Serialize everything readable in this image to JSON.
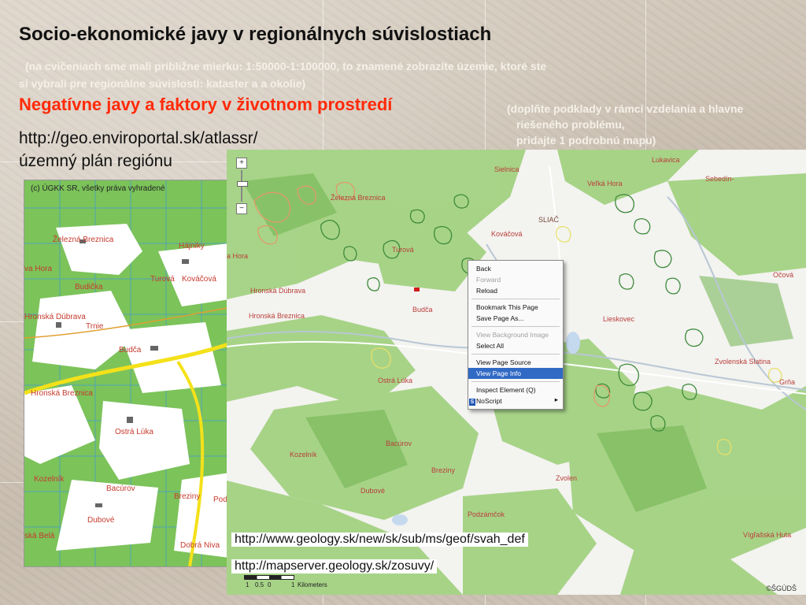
{
  "title": "Socio-ekonomické javy v regionálnych súvislostiach",
  "subnote_line1": "(na cvičeniach sme mali približne mierku: 1:50000-1:100000, to znamené zobrazíte územie, ktoré ste",
  "subnote_line2": "si vybrali pre regionálne súvislosti: kataster a a okolie)",
  "heading_red": "Negatívne javy a faktory v životnom prostredí",
  "heading_note_line1": "(doplňte podklady v rámci vzdelania a hlavne",
  "heading_note_line2": "riešeného problému,",
  "heading_note_line3": "pridajte 1 podrobnú mapu)",
  "url_atlas": "http://geo.enviroportal.sk/atlassr/",
  "url_atlas_caption": "územný plán regiónu",
  "left_map": {
    "copyright": "(c) ÚGKK SR, všetky práva vyhradené",
    "places": [
      "Železná Breznica",
      "Hájniky",
      "Turová",
      "Kováčová",
      "Budička",
      "Hronská Dúbrava",
      "Trnie",
      "Budča",
      "Hronská Breznica",
      "Ostrá Lúka",
      "Kozelník",
      "Bacúrov",
      "Breziny",
      "Dubové",
      "ská Belá",
      "Dobrá Niva",
      "va Hora",
      "Pod"
    ]
  },
  "main_map": {
    "places": [
      "Sielnica",
      "Lukavica",
      "Sebedín-",
      "Železná Breznica",
      "Veľká Hora",
      "Turová",
      "SLIAČ",
      "Kováčová",
      "Hronská Dúbrava",
      "Hronská Breznica",
      "Budča",
      "Lieskovec",
      "Zvolenská Slatina",
      "Ostrá Lúka",
      "Bacúrov",
      "Breziny",
      "Kozelník",
      "Dubové",
      "Podzámčok",
      "Zvolen",
      "Očová",
      "Vígľašská Huta",
      "Grňa",
      "a Hora"
    ],
    "scale_ticks": [
      "1",
      "0.5",
      "0",
      "1"
    ],
    "scale_unit": "Kilometers",
    "copyright": "©ŠGÚDŠ"
  },
  "context_menu": {
    "items": [
      {
        "label": "Back",
        "disabled": false
      },
      {
        "label": "Forward",
        "disabled": true
      },
      {
        "label": "Reload",
        "disabled": false
      },
      {
        "sep": true
      },
      {
        "label": "Bookmark This Page",
        "disabled": false
      },
      {
        "label": "Save Page As...",
        "disabled": false
      },
      {
        "sep": true
      },
      {
        "label": "View Background Image",
        "disabled": true
      },
      {
        "label": "Select All",
        "disabled": false
      },
      {
        "sep": true
      },
      {
        "label": "View Page Source",
        "disabled": false
      },
      {
        "label": "View Page Info",
        "disabled": false,
        "highlighted": true
      },
      {
        "sep": true
      },
      {
        "label": "Inspect Element (Q)",
        "disabled": false
      },
      {
        "label": "NoScript",
        "disabled": false,
        "submenu": true,
        "icon": "S"
      }
    ]
  },
  "links": {
    "svah": "http://www.geology.sk/new/sk/sub/ms/geof/svah_def",
    "zosuvy": "http://mapserver.geology.sk/zosuvy/"
  },
  "colors": {
    "title_red": "#ff2a0a",
    "menu_highlight": "#316ac5",
    "forest": "#8ec86a"
  }
}
